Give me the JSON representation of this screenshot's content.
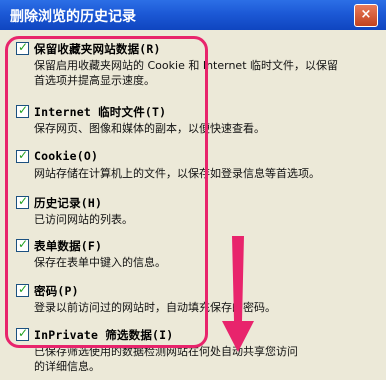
{
  "window": {
    "title": "删除浏览的历史记录",
    "close_label": "×"
  },
  "options": [
    {
      "label": "保留收藏夹网站数据(R)",
      "desc": [
        "保留启用收藏夹网站的 Cookie 和 Internet 临时文件，以保留",
        "首选项并提高显示速度。"
      ],
      "checked": true
    },
    {
      "label": "Internet 临时文件(T)",
      "desc": [
        "保存网页、图像和媒体的副本，以便快速查看。"
      ],
      "checked": true
    },
    {
      "label": "Cookie(O)",
      "desc": [
        "网站存储在计算机上的文件，以保存如登录信息等首选项。"
      ],
      "checked": true
    },
    {
      "label": "历史记录(H)",
      "desc": [
        "已访问网站的列表。"
      ],
      "checked": true
    },
    {
      "label": "表单数据(F)",
      "desc": [
        "保存在表单中键入的信息。"
      ],
      "checked": true
    },
    {
      "label": "密码(P)",
      "desc": [
        "登录以前访问过的网站时，自动填充保存的密码。"
      ],
      "checked": true
    },
    {
      "label": "InPrivate 筛选数据(I)",
      "desc": [
        "已保存筛选使用的数据检测网站在何处自动共享您访问",
        "的详细信息。"
      ],
      "checked": true
    }
  ],
  "annotation": {
    "highlight_color": "#e8246c",
    "arrow_color": "#e8246c"
  }
}
